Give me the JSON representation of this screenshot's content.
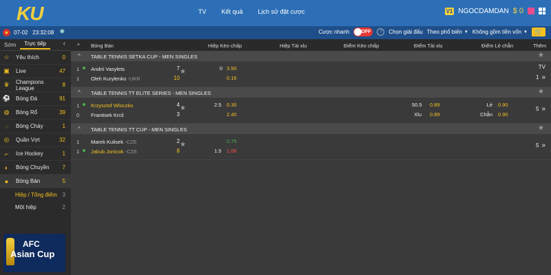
{
  "header": {
    "logo": "KU",
    "nav": [
      "TV",
      "Kết quả",
      "Lịch sử đặt cược"
    ],
    "vip": "V1",
    "username": "NGOCDAMDAN",
    "balance": "$ 0"
  },
  "subbar": {
    "date": "07-02",
    "time": "23:32:08",
    "quick_bet_label": "Cược nhanh",
    "toggle_state": "OFF",
    "choose_league": "Chọn giải đấu",
    "sort_by": "Theo phổ biến",
    "currency": "Không gồm tiền vốn"
  },
  "sidebar": {
    "tabs": [
      "Sớm",
      "Trực tiếp"
    ],
    "items": [
      {
        "label": "Yêu thích",
        "count": "0",
        "icon": "star-icon"
      },
      {
        "label": "Live",
        "count": "47",
        "icon": "tv-icon"
      },
      {
        "label": "Champions League",
        "count": "8",
        "icon": "trophy-icon"
      },
      {
        "label": "Bóng Đá",
        "count": "91",
        "icon": "soccer-icon"
      },
      {
        "label": "Bóng Rổ",
        "count": "39",
        "icon": "basketball-icon"
      },
      {
        "label": "Bóng Chày",
        "count": "1",
        "icon": "baseball-icon"
      },
      {
        "label": "Quần Vợt",
        "count": "32",
        "icon": "tennis-icon"
      },
      {
        "label": "Ice Hockey",
        "count": "1",
        "icon": "hockey-icon"
      },
      {
        "label": "Bóng Chuyền",
        "count": "7",
        "icon": "volleyball-icon"
      },
      {
        "label": "Bóng Bàn",
        "count": "5",
        "icon": "table-tennis-icon"
      }
    ],
    "subitems": [
      {
        "label": "Hiệp / Tổng điểm",
        "count": "3"
      },
      {
        "label": "Một hiệp",
        "count": "2"
      }
    ],
    "banner": {
      "line1": "AFC",
      "line2": "Asian Cup"
    }
  },
  "columns": {
    "sport": "Bóng Bàn",
    "hc": "Hiệp Kèo chấp",
    "ou": "Hiệp Tài xỉu",
    "pt_hc": "Điểm Kèo chấp",
    "pt_ou": "Điểm Tài xỉu",
    "pt_oe": "Điểm Lẻ chẵn",
    "more": "Thêm"
  },
  "sections": [
    {
      "title": "TABLE TENNIS SETKA CUP - MEN SINGLES",
      "right_top": "TV",
      "right_bottom": "1",
      "home": {
        "pos": "1",
        "live": true,
        "team": "Andrii Vasylets",
        "country": "",
        "score": "7",
        "hc": "0",
        "hc_odd": "3.50",
        "highlight": false
      },
      "away": {
        "pos": "1",
        "live": false,
        "team": "Oleh Kurylenko",
        "country": " -UKR",
        "score": "10",
        "hc": "",
        "hc_odd": "0.16",
        "highlight": false
      }
    },
    {
      "title": "TABLE TENNIS TT ELITE SERIES - MEN SINGLES",
      "right_top": "",
      "right_bottom": "5",
      "home": {
        "pos": "1",
        "live": true,
        "team": "Krzysztof Wloczko",
        "country": "",
        "score": "4",
        "hc": "2.5",
        "hc_odd": "0.30",
        "ou": "50.5",
        "ou_odd": "0.89",
        "oe_label": "Lẻ",
        "oe_odd": "0.90",
        "highlight": true
      },
      "away": {
        "pos": "0",
        "live": false,
        "team": "Frantisek Krcil",
        "country": "",
        "score": "3",
        "hc": "",
        "hc_odd": "2.40",
        "ou": "Xỉu",
        "ou_odd": "0.89",
        "oe_label": "Chẵn",
        "oe_odd": "0.90",
        "highlight": false
      }
    },
    {
      "title": "TABLE TENNIS TT CUP - MEN SINGLES",
      "right_top": "",
      "right_bottom": "5",
      "home": {
        "pos": "1",
        "live": false,
        "team": "Marek Kulisek",
        "country": " -CZE",
        "score": "2",
        "hc": "",
        "hc_odd": "0.75",
        "highlight": false
      },
      "away": {
        "pos": "1",
        "live": true,
        "team": "Jakub Jonicok",
        "country": " -CZE",
        "score": "8",
        "hc": "1.5",
        "hc_odd": "1.06",
        "highlight": true
      }
    }
  ]
}
